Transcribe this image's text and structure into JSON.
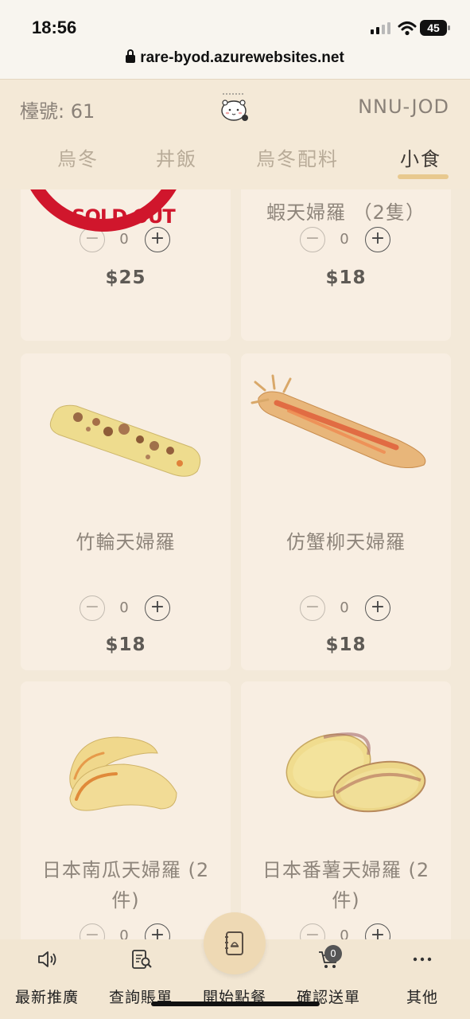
{
  "status_bar": {
    "time": "18:56",
    "battery": "45"
  },
  "browser": {
    "url": "rare-byod.azurewebsites.net"
  },
  "header": {
    "table_label": "檯號: 61",
    "order_code": "NNU-JOD",
    "logo_icon": "udon-bear-logo"
  },
  "tabs": [
    {
      "label": "烏冬",
      "active": false
    },
    {
      "label": "丼飯",
      "active": false
    },
    {
      "label": "烏冬配料",
      "active": false
    },
    {
      "label": "小食",
      "active": true
    }
  ],
  "products": [
    {
      "name": "",
      "qty": "0",
      "price": "$25",
      "sold_out": true,
      "sold_out_label": "SOLD OUT"
    },
    {
      "name": "蝦天婦羅 （2隻）",
      "qty": "0",
      "price": "$18"
    },
    {
      "name": "竹輪天婦羅",
      "qty": "0",
      "price": "$18",
      "image": "chikuwa-tempura"
    },
    {
      "name": "仿蟹柳天婦羅",
      "qty": "0",
      "price": "$18",
      "image": "crab-stick-tempura"
    },
    {
      "name": "日本南瓜天婦羅 (2件)",
      "qty": "0",
      "image": "pumpkin-tempura"
    },
    {
      "name": "日本番薯天婦羅 (2件)",
      "qty": "0",
      "image": "sweet-potato-tempura"
    }
  ],
  "bottom_nav": [
    {
      "label": "最新推廣",
      "icon": "speaker-icon"
    },
    {
      "label": "查詢賬單",
      "icon": "bill-search-icon"
    },
    {
      "label": "開始點餐",
      "icon": "menu-book-icon"
    },
    {
      "label": "確認送單",
      "icon": "cart-icon",
      "badge": "0"
    },
    {
      "label": "其他",
      "icon": "more-icon"
    }
  ],
  "colors": {
    "background": "#f3e9d9",
    "card": "#f8eee2",
    "accent": "#e8c98f",
    "sold_out_red": "#d0162c"
  }
}
